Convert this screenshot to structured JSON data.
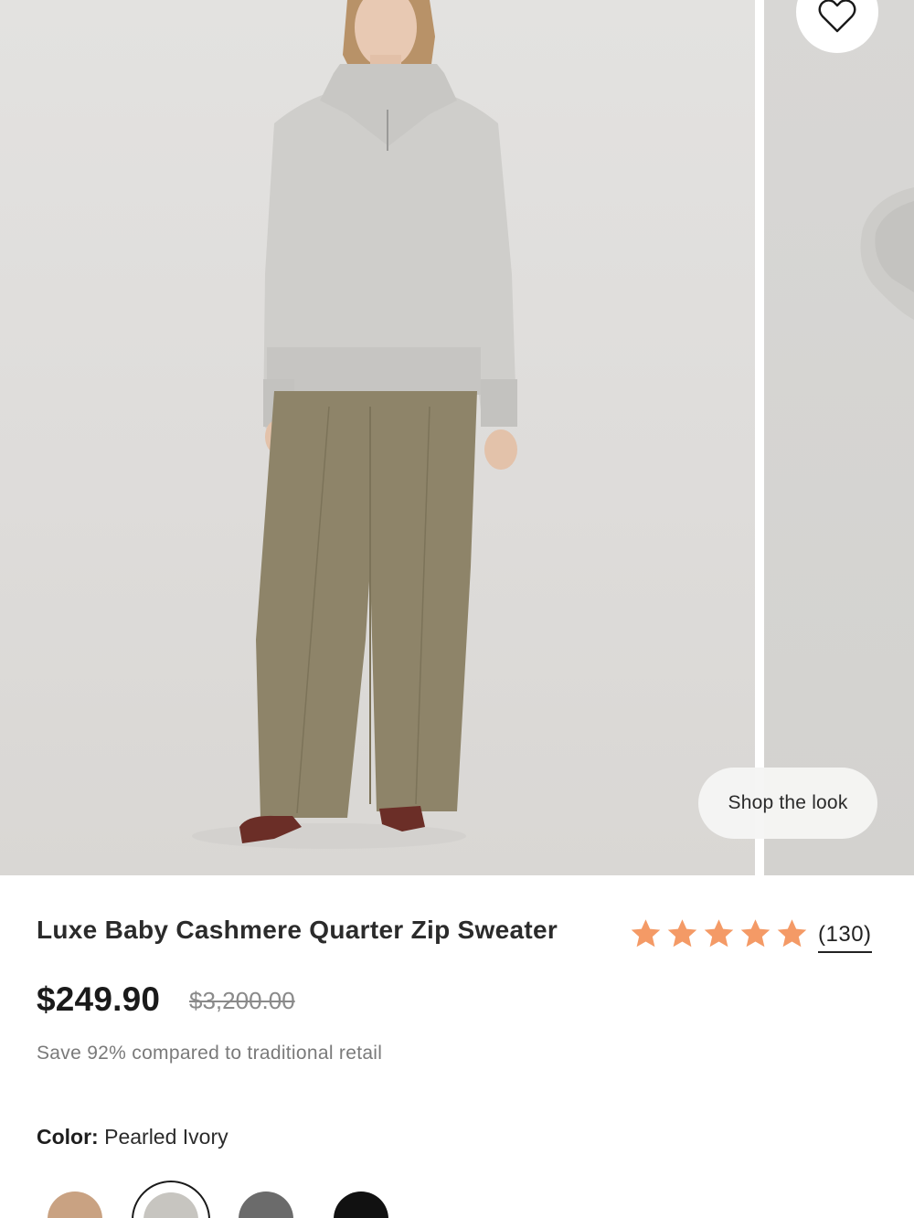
{
  "gallery": {
    "wishlist_icon": "heart-outline-icon",
    "shop_the_look_label": "Shop the look"
  },
  "product": {
    "title": "Luxe Baby Cashmere Quarter Zip Sweater",
    "rating": {
      "stars": 5,
      "star_color": "#f49a66",
      "review_count": "(130)"
    },
    "price": "$249.90",
    "compare_at_price": "$3,200.00",
    "savings_text": "Save 92% compared to traditional retail",
    "color": {
      "label": "Color:",
      "selected": "Pearled Ivory",
      "swatches": [
        {
          "name": "camel",
          "hex": "#c9a282"
        },
        {
          "name": "pearled-ivory",
          "hex": "#c7c5c0",
          "selected": true
        },
        {
          "name": "charcoal",
          "hex": "#6b6b6b"
        },
        {
          "name": "black",
          "hex": "#111111"
        }
      ]
    }
  }
}
